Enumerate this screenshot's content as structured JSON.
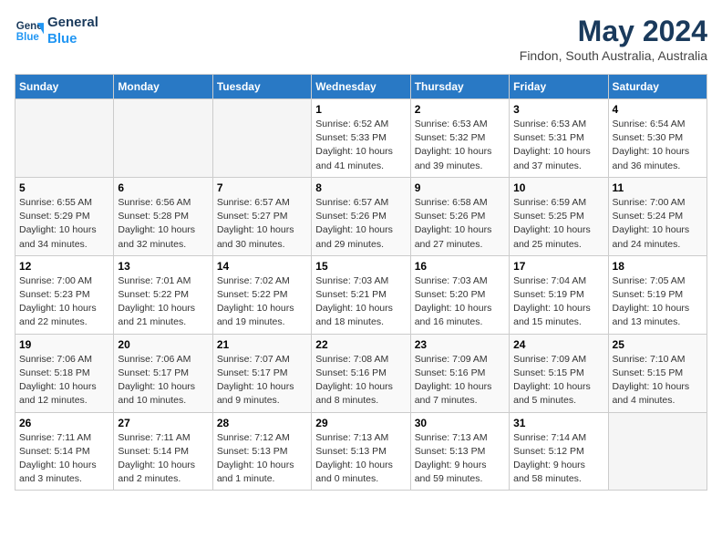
{
  "header": {
    "logo_line1": "General",
    "logo_line2": "Blue",
    "main_title": "May 2024",
    "subtitle": "Findon, South Australia, Australia"
  },
  "calendar": {
    "headers": [
      "Sunday",
      "Monday",
      "Tuesday",
      "Wednesday",
      "Thursday",
      "Friday",
      "Saturday"
    ],
    "weeks": [
      [
        {
          "day": "",
          "info": ""
        },
        {
          "day": "",
          "info": ""
        },
        {
          "day": "",
          "info": ""
        },
        {
          "day": "1",
          "info": "Sunrise: 6:52 AM\nSunset: 5:33 PM\nDaylight: 10 hours\nand 41 minutes."
        },
        {
          "day": "2",
          "info": "Sunrise: 6:53 AM\nSunset: 5:32 PM\nDaylight: 10 hours\nand 39 minutes."
        },
        {
          "day": "3",
          "info": "Sunrise: 6:53 AM\nSunset: 5:31 PM\nDaylight: 10 hours\nand 37 minutes."
        },
        {
          "day": "4",
          "info": "Sunrise: 6:54 AM\nSunset: 5:30 PM\nDaylight: 10 hours\nand 36 minutes."
        }
      ],
      [
        {
          "day": "5",
          "info": "Sunrise: 6:55 AM\nSunset: 5:29 PM\nDaylight: 10 hours\nand 34 minutes."
        },
        {
          "day": "6",
          "info": "Sunrise: 6:56 AM\nSunset: 5:28 PM\nDaylight: 10 hours\nand 32 minutes."
        },
        {
          "day": "7",
          "info": "Sunrise: 6:57 AM\nSunset: 5:27 PM\nDaylight: 10 hours\nand 30 minutes."
        },
        {
          "day": "8",
          "info": "Sunrise: 6:57 AM\nSunset: 5:26 PM\nDaylight: 10 hours\nand 29 minutes."
        },
        {
          "day": "9",
          "info": "Sunrise: 6:58 AM\nSunset: 5:26 PM\nDaylight: 10 hours\nand 27 minutes."
        },
        {
          "day": "10",
          "info": "Sunrise: 6:59 AM\nSunset: 5:25 PM\nDaylight: 10 hours\nand 25 minutes."
        },
        {
          "day": "11",
          "info": "Sunrise: 7:00 AM\nSunset: 5:24 PM\nDaylight: 10 hours\nand 24 minutes."
        }
      ],
      [
        {
          "day": "12",
          "info": "Sunrise: 7:00 AM\nSunset: 5:23 PM\nDaylight: 10 hours\nand 22 minutes."
        },
        {
          "day": "13",
          "info": "Sunrise: 7:01 AM\nSunset: 5:22 PM\nDaylight: 10 hours\nand 21 minutes."
        },
        {
          "day": "14",
          "info": "Sunrise: 7:02 AM\nSunset: 5:22 PM\nDaylight: 10 hours\nand 19 minutes."
        },
        {
          "day": "15",
          "info": "Sunrise: 7:03 AM\nSunset: 5:21 PM\nDaylight: 10 hours\nand 18 minutes."
        },
        {
          "day": "16",
          "info": "Sunrise: 7:03 AM\nSunset: 5:20 PM\nDaylight: 10 hours\nand 16 minutes."
        },
        {
          "day": "17",
          "info": "Sunrise: 7:04 AM\nSunset: 5:19 PM\nDaylight: 10 hours\nand 15 minutes."
        },
        {
          "day": "18",
          "info": "Sunrise: 7:05 AM\nSunset: 5:19 PM\nDaylight: 10 hours\nand 13 minutes."
        }
      ],
      [
        {
          "day": "19",
          "info": "Sunrise: 7:06 AM\nSunset: 5:18 PM\nDaylight: 10 hours\nand 12 minutes."
        },
        {
          "day": "20",
          "info": "Sunrise: 7:06 AM\nSunset: 5:17 PM\nDaylight: 10 hours\nand 10 minutes."
        },
        {
          "day": "21",
          "info": "Sunrise: 7:07 AM\nSunset: 5:17 PM\nDaylight: 10 hours\nand 9 minutes."
        },
        {
          "day": "22",
          "info": "Sunrise: 7:08 AM\nSunset: 5:16 PM\nDaylight: 10 hours\nand 8 minutes."
        },
        {
          "day": "23",
          "info": "Sunrise: 7:09 AM\nSunset: 5:16 PM\nDaylight: 10 hours\nand 7 minutes."
        },
        {
          "day": "24",
          "info": "Sunrise: 7:09 AM\nSunset: 5:15 PM\nDaylight: 10 hours\nand 5 minutes."
        },
        {
          "day": "25",
          "info": "Sunrise: 7:10 AM\nSunset: 5:15 PM\nDaylight: 10 hours\nand 4 minutes."
        }
      ],
      [
        {
          "day": "26",
          "info": "Sunrise: 7:11 AM\nSunset: 5:14 PM\nDaylight: 10 hours\nand 3 minutes."
        },
        {
          "day": "27",
          "info": "Sunrise: 7:11 AM\nSunset: 5:14 PM\nDaylight: 10 hours\nand 2 minutes."
        },
        {
          "day": "28",
          "info": "Sunrise: 7:12 AM\nSunset: 5:13 PM\nDaylight: 10 hours\nand 1 minute."
        },
        {
          "day": "29",
          "info": "Sunrise: 7:13 AM\nSunset: 5:13 PM\nDaylight: 10 hours\nand 0 minutes."
        },
        {
          "day": "30",
          "info": "Sunrise: 7:13 AM\nSunset: 5:13 PM\nDaylight: 9 hours\nand 59 minutes."
        },
        {
          "day": "31",
          "info": "Sunrise: 7:14 AM\nSunset: 5:12 PM\nDaylight: 9 hours\nand 58 minutes."
        },
        {
          "day": "",
          "info": ""
        }
      ]
    ]
  }
}
